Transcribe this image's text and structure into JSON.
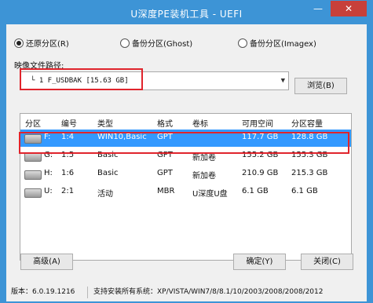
{
  "window": {
    "title": "U深度PE装机工具 - UEFI",
    "minimize_label": "—",
    "close_label": "✕"
  },
  "modes": [
    {
      "label": "还原分区(R)",
      "selected": true
    },
    {
      "label": "备份分区(Ghost)",
      "selected": false
    },
    {
      "label": "备份分区(Imagex)",
      "selected": false
    }
  ],
  "image_path": {
    "label": "映像文件路径:",
    "value": "└ 1 F_USDBAK [15.63 GB]",
    "browse_label": "浏览(B)"
  },
  "partition_table": {
    "columns": [
      "分区",
      "编号",
      "类型",
      "格式",
      "卷标",
      "可用空间",
      "分区容量"
    ],
    "rows": [
      {
        "partition": "F:",
        "number": "1:4",
        "type": "WIN10,Basic",
        "format": "GPT",
        "label": "",
        "free": "117.7 GB",
        "capacity": "128.8 GB",
        "selected": true
      },
      {
        "partition": "G:",
        "number": "1:5",
        "type": "Basic",
        "format": "GPT",
        "label": "新加卷",
        "free": "155.2 GB",
        "capacity": "155.3 GB",
        "selected": false
      },
      {
        "partition": "H:",
        "number": "1:6",
        "type": "Basic",
        "format": "GPT",
        "label": "新加卷",
        "free": "210.9 GB",
        "capacity": "215.3 GB",
        "selected": false
      },
      {
        "partition": "U:",
        "number": "2:1",
        "type": "活动",
        "format": "MBR",
        "label": "U深度U盘",
        "free": "6.1 GB",
        "capacity": "6.1 GB",
        "selected": false
      }
    ]
  },
  "buttons": {
    "advanced": "高级(A)",
    "ok": "确定(Y)",
    "close": "关闭(C)"
  },
  "status": {
    "version": "版本：6.0.19.1216",
    "systems": "支持安装所有系统：XP/VISTA/WIN7/8/8.1/10/2003/2008/2008/2012"
  }
}
